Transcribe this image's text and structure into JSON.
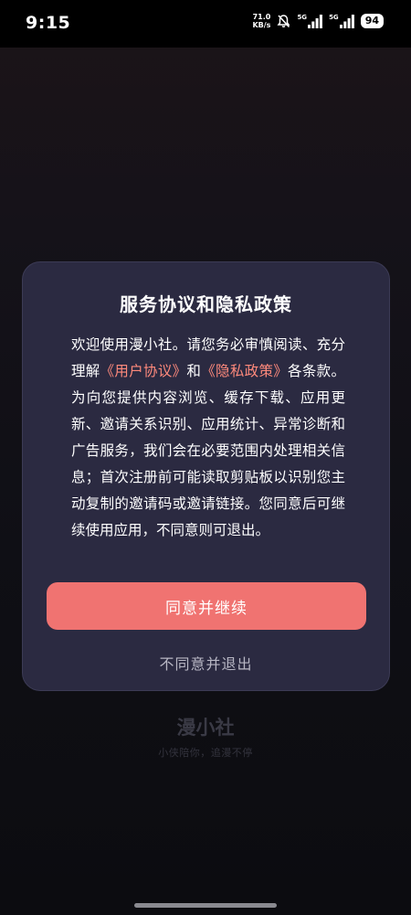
{
  "status_bar": {
    "time": "9:15",
    "net_speed_value": "71.0",
    "net_speed_unit": "KB/s",
    "signal1_label": "5G",
    "signal2_label": "5G",
    "battery": "94"
  },
  "dialog": {
    "title": "服务协议和隐私政策",
    "body_intro": "欢迎使用漫小社。请您务必审慎阅读、充分理解",
    "link_user_agreement": "《用户协议》",
    "conjunction": "和",
    "link_privacy_policy": "《隐私政策》",
    "body_rest": "各条款。为向您提供内容浏览、缓存下载、应用更新、邀请关系识别、应用统计、异常诊断和广告服务，我们会在必要范围内处理相关信息；首次注册前可能读取剪贴板以识别您主动复制的邀请码或邀请链接。您同意后可继续使用应用，不同意则可退出。",
    "agree_label": "同意并继续",
    "disagree_label": "不同意并退出"
  },
  "brand": {
    "logo": "漫小社",
    "slogan": "小侠陪你，追漫不停"
  },
  "colors": {
    "dialog_bg": "#2b2a41",
    "accent_link": "#ff8a7c",
    "agree_button": "#f07371"
  }
}
